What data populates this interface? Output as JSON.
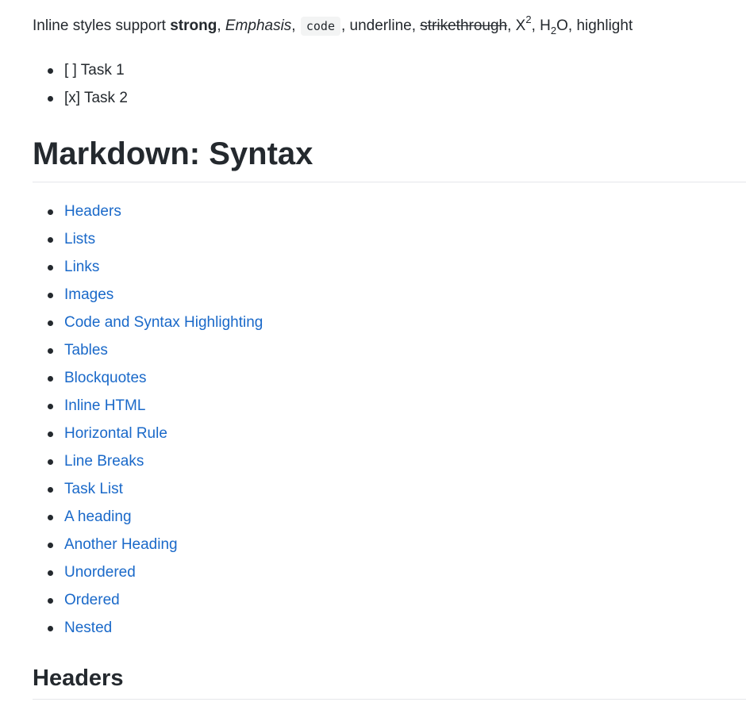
{
  "inline": {
    "prefix": "Inline styles support ",
    "strong": "strong",
    "sep1": ", ",
    "emphasis": "Emphasis",
    "sep2": ", ",
    "code": "code",
    "sep3": ", underline, ",
    "strike": "strikethrough",
    "sep4": ", X",
    "sup": "2",
    "sep5": ", H",
    "sub": "2",
    "sep6": "O, highlight"
  },
  "tasks": [
    "[ ] Task 1",
    "[x] Task 2"
  ],
  "title": "Markdown: Syntax",
  "toc": [
    "Headers",
    "Lists",
    "Links",
    "Images",
    "Code and Syntax Highlighting",
    "Tables",
    "Blockquotes",
    "Inline HTML",
    "Horizontal Rule",
    "Line Breaks",
    "Task List",
    "A heading",
    "Another Heading",
    "Unordered",
    "Ordered",
    "Nested"
  ],
  "section_heading": "Headers",
  "colors": {
    "text": "#24292e",
    "link": "#1a69c9",
    "code_bg": "#f3f4f4",
    "rule": "#e5e7ea"
  }
}
